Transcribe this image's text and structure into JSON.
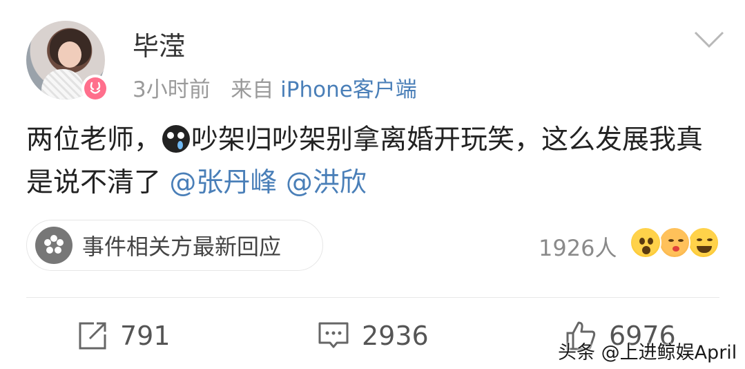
{
  "post": {
    "username": "毕滢",
    "time": "3小时前",
    "source_prefix": "来自",
    "source": "iPhone客户端",
    "content_part1": "两位老师，",
    "content_part2": "吵架归吵架别拿离婚开玩笑，这么发展我真是说不清了",
    "mention1": "@张丹峰",
    "mention2": "@洪欣",
    "emoji_icon": "crying-face-icon"
  },
  "event": {
    "label": "事件相关方最新回应",
    "icon": "flower-icon"
  },
  "reactions": {
    "count": "1926人",
    "icons": [
      "surprised-emoji-icon",
      "kiss-emoji-icon",
      "laugh-emoji-icon"
    ]
  },
  "actions": {
    "forward_count": "791",
    "comment_count": "2936",
    "like_count": "6976"
  },
  "watermark": {
    "text": "头条 @上进鲸娱April"
  },
  "colors": {
    "link": "#4a7fb8",
    "muted": "#9a9a9a",
    "vip_badge": "#ff6f8c"
  }
}
